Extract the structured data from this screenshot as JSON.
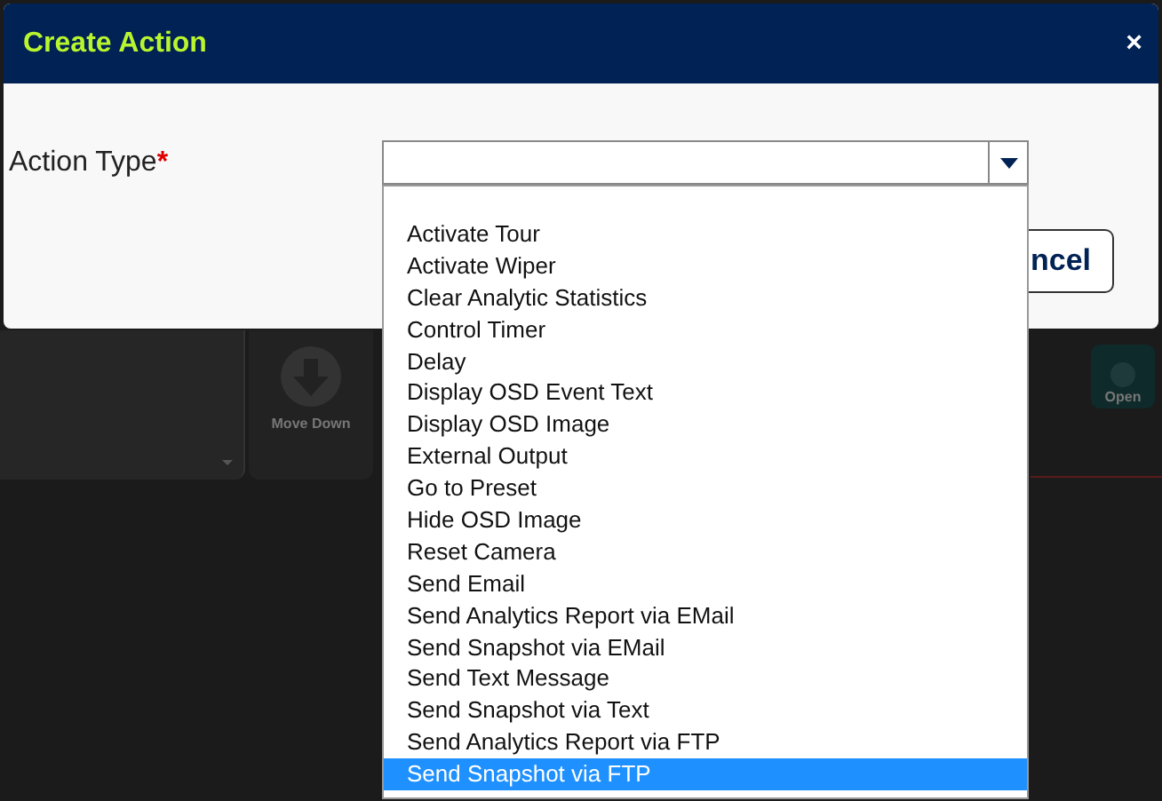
{
  "background": {
    "buttons": [
      {
        "label": "Move Down"
      },
      {
        "label": "Open"
      }
    ]
  },
  "dialog": {
    "title": "Create Action",
    "close": "×",
    "field": {
      "label": "Action Type",
      "required": "*"
    },
    "button": "ncel"
  },
  "dropdown": {
    "options": [
      {
        "label": "Activate Tour",
        "selected": false
      },
      {
        "label": "Activate Wiper",
        "selected": false
      },
      {
        "label": "Clear Analytic Statistics",
        "selected": false
      },
      {
        "label": "Control Timer",
        "selected": false
      },
      {
        "label": "Delay",
        "selected": false
      },
      {
        "label": "Display OSD Event Text",
        "selected": false
      },
      {
        "label": "Display OSD Image",
        "selected": false
      },
      {
        "label": "External Output",
        "selected": false
      },
      {
        "label": "Go to Preset",
        "selected": false
      },
      {
        "label": "Hide OSD Image",
        "selected": false
      },
      {
        "label": "Reset Camera",
        "selected": false
      },
      {
        "label": "Send Email",
        "selected": false
      },
      {
        "label": "Send Analytics Report via EMail",
        "selected": false
      },
      {
        "label": "Send Snapshot via EMail",
        "selected": false
      },
      {
        "label": "Send Text Message",
        "selected": false
      },
      {
        "label": "Send Snapshot via Text",
        "selected": false
      },
      {
        "label": "Send Analytics Report via FTP",
        "selected": false
      },
      {
        "label": "Send Snapshot via FTP",
        "selected": true
      }
    ]
  }
}
